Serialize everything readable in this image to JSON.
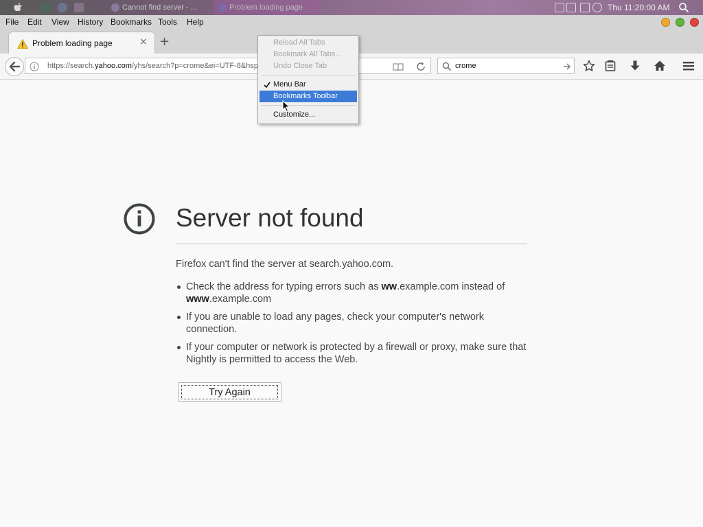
{
  "system_bar": {
    "tasks": [
      {
        "label": "Cannot find server - ..."
      },
      {
        "label": "Problem loading page"
      }
    ],
    "clock": "Thu 11:20:00 AM"
  },
  "menu_bar": {
    "items": [
      {
        "label": "File",
        "accel": "F"
      },
      {
        "label": "Edit",
        "accel": "E"
      },
      {
        "label": "View",
        "accel": "V"
      },
      {
        "label": "History",
        "accel": "s"
      },
      {
        "label": "Bookmarks",
        "accel": "B"
      },
      {
        "label": "Tools",
        "accel": "T"
      },
      {
        "label": "Help",
        "accel": "H"
      }
    ]
  },
  "tab": {
    "title": "Problem loading page",
    "close_glyph": "×",
    "new_tab_glyph": "+"
  },
  "nav": {
    "url_prefix": "https://search.",
    "url_domain": "yahoo.com",
    "url_rest": "/yhs/search?p=crome&ei=UTF-8&hspa",
    "search_value": "crome"
  },
  "context_menu": {
    "items": [
      {
        "label": "Reload All Tabs",
        "disabled": true
      },
      {
        "label": "Bookmark All Tabs...",
        "disabled": true
      },
      {
        "label": "Undo Close Tab",
        "disabled": true
      },
      {
        "label": "Menu Bar",
        "checked": true
      },
      {
        "label": "Bookmarks Toolbar",
        "highlighted": true
      },
      {
        "label": "Customize..."
      }
    ]
  },
  "error_page": {
    "title": "Server not found",
    "description": "Firefox can't find the server at search.yahoo.com.",
    "bullet1_a": "Check the address for typing errors such as ",
    "bullet1_b1": "ww",
    "bullet1_c": ".example.com instead of ",
    "bullet1_b2": "www",
    "bullet1_d": ".example.com",
    "bullet2": "If you are unable to load any pages, check your computer's network connection.",
    "bullet3": "If your computer or network is protected by a firewall or proxy, make sure that Nightly is permitted to access the Web.",
    "try_again_label": "Try Again"
  },
  "colors": {
    "menu_highlight": "#3d7bd8",
    "window_close": "#e0443e",
    "window_minimize": "#f0a92c",
    "window_zoom": "#5fb33a"
  }
}
